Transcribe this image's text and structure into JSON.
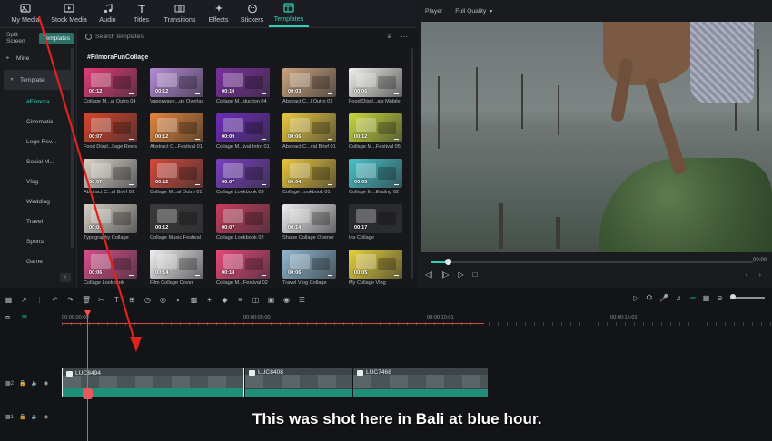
{
  "tabs": [
    {
      "label": "My Media",
      "icon": "media-icon"
    },
    {
      "label": "Stock Media",
      "icon": "stock-media-icon"
    },
    {
      "label": "Audio",
      "icon": "music-note-icon"
    },
    {
      "label": "Titles",
      "icon": "text-t-icon"
    },
    {
      "label": "Transitions",
      "icon": "transitions-icon"
    },
    {
      "label": "Effects",
      "icon": "effects-icon"
    },
    {
      "label": "Stickers",
      "icon": "stickers-icon"
    },
    {
      "label": "Templates",
      "icon": "templates-icon"
    }
  ],
  "sidebar": {
    "toggle": [
      "Split Screen",
      "Templates"
    ],
    "items": [
      {
        "label": "Mine",
        "type": "group"
      },
      {
        "label": "Template",
        "type": "group-open"
      },
      {
        "label": "#Filmora",
        "type": "sub-active"
      },
      {
        "label": "Cinematic",
        "type": "sub"
      },
      {
        "label": "Logo Rev...",
        "type": "sub"
      },
      {
        "label": "Social M...",
        "type": "sub"
      },
      {
        "label": "Vlog",
        "type": "sub"
      },
      {
        "label": "Wedding",
        "type": "sub"
      },
      {
        "label": "Travel",
        "type": "sub"
      },
      {
        "label": "Sports",
        "type": "sub"
      },
      {
        "label": "Game",
        "type": "sub"
      }
    ]
  },
  "gallery": {
    "search_placeholder": "Search templates",
    "heading": "#FilmoraFunCollage",
    "cards": [
      {
        "caption": "Collage M...al Outro 04",
        "duration": "00:12",
        "bg": "#e03b74"
      },
      {
        "caption": "Vaporwave...ge Overlay",
        "duration": "00:12",
        "bg": "#b58ad6"
      },
      {
        "caption": "Collage M...duction 04",
        "duration": "00:10",
        "bg": "#7c2f9e"
      },
      {
        "caption": "Abstract C...l Outro 01",
        "duration": "00:03",
        "bg": "#c9a27d"
      },
      {
        "caption": "Food Displ...als Mobile",
        "duration": "00:06",
        "bg": "#f1efe9"
      },
      {
        "caption": "Food Displ...llage Reels",
        "duration": "00:07",
        "bg": "#d7452b"
      },
      {
        "caption": "Abstract C...Festival 01",
        "duration": "00:12",
        "bg": "#e2853a"
      },
      {
        "caption": "Collage M...ival Intro 01",
        "duration": "00:09",
        "bg": "#6c2bb8"
      },
      {
        "caption": "Abstract C...val Brief 01",
        "duration": "00:06",
        "bg": "#e8c840"
      },
      {
        "caption": "Collage M...Festival 05",
        "duration": "00:12",
        "bg": "#c8d83d"
      },
      {
        "caption": "Abstract C...al Brief 01",
        "duration": "00:07",
        "bg": "#d9d3c8"
      },
      {
        "caption": "Collage M...al Outro 01",
        "duration": "00:12",
        "bg": "#d44a3b"
      },
      {
        "caption": "Collage Lookbook 03",
        "duration": "00:07",
        "bg": "#7a3fc0"
      },
      {
        "caption": "Collage Lookbook 01",
        "duration": "00:04",
        "bg": "#e7c43c"
      },
      {
        "caption": "Collage M...Ending 02",
        "duration": "00:05",
        "bg": "#48c2c9"
      },
      {
        "caption": "Typography Collage",
        "duration": "00:05",
        "bg": "#d6cfc4"
      },
      {
        "caption": "Collage Music Festival",
        "duration": "00:12",
        "bg": "#3b3a3a"
      },
      {
        "caption": "Collage Lookbook 02",
        "duration": "00:07",
        "bg": "#c63d5e"
      },
      {
        "caption": "Shape Collage Opener",
        "duration": "00:14",
        "bg": "#eeeeee"
      },
      {
        "caption": "Ins Collage",
        "duration": "00:17",
        "bg": "#2a2b2e"
      },
      {
        "caption": "Collage Lookbook",
        "duration": "00:06",
        "bg": "#d94f8c"
      },
      {
        "caption": "Film Collage Cover",
        "duration": "00:14",
        "bg": "#f1f1f1"
      },
      {
        "caption": "Collage M...Festival 02",
        "duration": "00:18",
        "bg": "#e8487b"
      },
      {
        "caption": "Travel Vlog Collage",
        "duration": "00:06",
        "bg": "#8fb7cf"
      },
      {
        "caption": "My Collage Vlog",
        "duration": "00:05",
        "bg": "#e7d13b"
      }
    ]
  },
  "player": {
    "label": "Player",
    "quality": "Full Quality",
    "time_right": "00:00"
  },
  "timeline": {
    "ruler": [
      "00:00:00:00",
      "00:00:05:00",
      "00:00:10:01",
      "00:00:15:01"
    ],
    "tracks": [
      {
        "label": "2"
      },
      {
        "label": "1"
      }
    ],
    "clips": [
      {
        "name": "LUC8494",
        "selected": true
      },
      {
        "name": "LUC8408",
        "selected": false
      },
      {
        "name": "LUC7468",
        "selected": false
      }
    ],
    "subtitle": "This was shot here in Bali at blue hour."
  },
  "colors": {
    "accent": "#2fd1b6",
    "playhead": "#ff4d4d",
    "annotation_arrow": "#e0221f"
  }
}
